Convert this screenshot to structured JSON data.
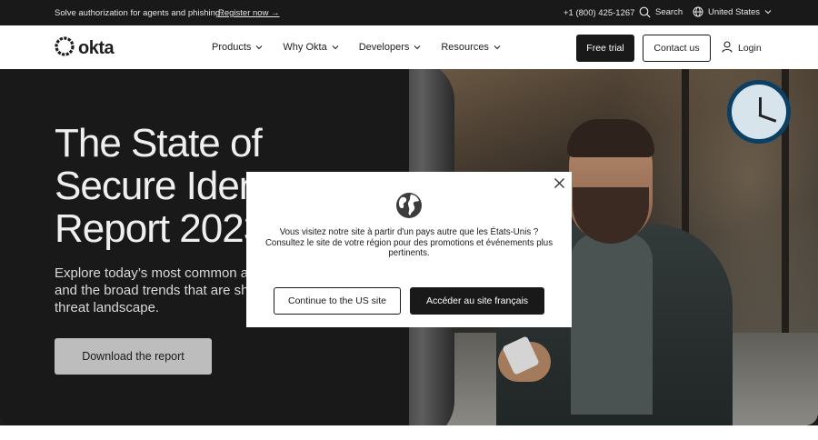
{
  "topbar": {
    "promo": "Solve authorization for agents and phishing.",
    "register": "Register now →",
    "phone": "+1 (800) 425-1267",
    "search": "Search",
    "region": "United States"
  },
  "nav": {
    "logo": "okta",
    "menu": [
      "Products",
      "Why Okta",
      "Developers",
      "Resources"
    ],
    "free_trial": "Free trial",
    "contact": "Contact us",
    "login": "Login"
  },
  "hero": {
    "title": "The State of\nSecure Iden\nReport 2023",
    "subtitle": "Explore today’s most common att\nand the broad trends that are sha\nthreat landscape.",
    "button": "Download the report"
  },
  "modal": {
    "message": "Vous visitez notre site à partir d'un pays autre que les États-Unis ?\nConsultez le site de votre région pour des promotions et événements plus\npertinents.",
    "btn_us": "Continue to the US site",
    "btn_fr": "Accéder au site français",
    "icons": [
      "globe-icon",
      "close-icon"
    ]
  },
  "colors": {
    "dark": "#191919",
    "light": "#ffffff",
    "hero_button": "#bdbdbd",
    "clock_ring": "#0b3f63"
  }
}
